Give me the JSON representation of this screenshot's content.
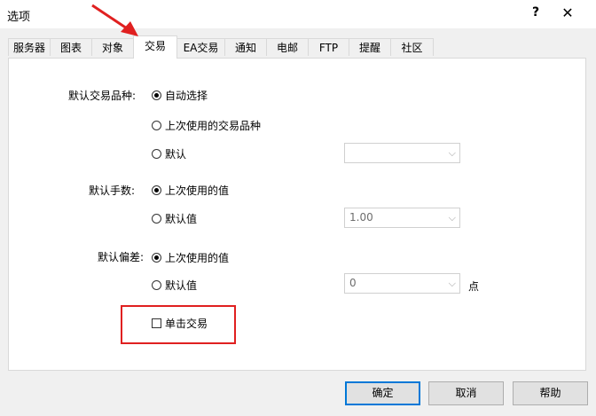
{
  "window": {
    "title": "选项",
    "help_glyph": "?",
    "close_glyph": "✕"
  },
  "tabs": [
    {
      "label": "服务器",
      "active": false
    },
    {
      "label": "图表",
      "active": false
    },
    {
      "label": "对象",
      "active": false
    },
    {
      "label": "交易",
      "active": true
    },
    {
      "label": "EA交易",
      "active": false
    },
    {
      "label": "通知",
      "active": false
    },
    {
      "label": "电邮",
      "active": false
    },
    {
      "label": "FTP",
      "active": false
    },
    {
      "label": "提醒",
      "active": false
    },
    {
      "label": "社区",
      "active": false
    }
  ],
  "trade": {
    "symbol_group": {
      "label": "默认交易品种:",
      "options": [
        {
          "label": "自动选择",
          "selected": true
        },
        {
          "label": "上次使用的交易品种",
          "selected": false
        },
        {
          "label": "默认",
          "selected": false
        }
      ],
      "combo_value": ""
    },
    "lots_group": {
      "label": "默认手数:",
      "options": [
        {
          "label": "上次使用的值",
          "selected": true
        },
        {
          "label": "默认值",
          "selected": false
        }
      ],
      "combo_value": "1.00"
    },
    "deviation_group": {
      "label": "默认偏差:",
      "options": [
        {
          "label": "上次使用的值",
          "selected": true
        },
        {
          "label": "默认值",
          "selected": false
        }
      ],
      "combo_value": "0",
      "unit": "点"
    },
    "one_click": {
      "label": "单击交易",
      "checked": false
    }
  },
  "buttons": {
    "ok": "确定",
    "cancel": "取消",
    "help": "帮助"
  },
  "colors": {
    "annotation": "#e02020"
  }
}
